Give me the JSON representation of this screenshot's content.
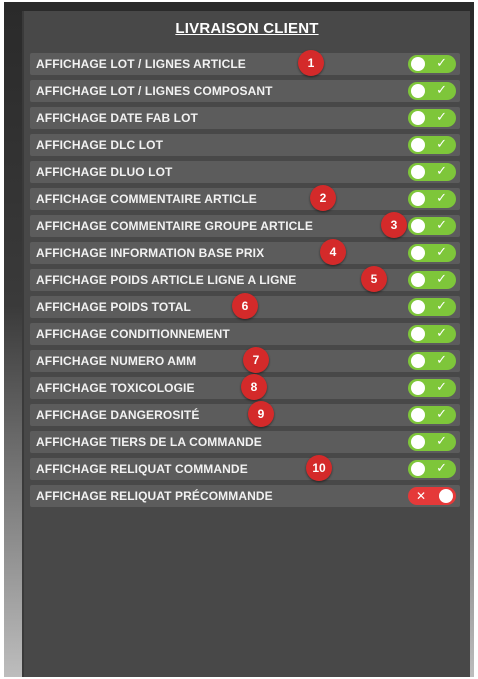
{
  "title": "LIVRAISON CLIENT",
  "colors": {
    "toggle_on": "#7ec63a",
    "toggle_off": "#e53939",
    "badge": "#d42a2a"
  },
  "rows": [
    {
      "label": "AFFICHAGE LOT / LIGNES ARTICLE",
      "enabled": true,
      "badge": "1"
    },
    {
      "label": "AFFICHAGE LOT / LIGNES COMPOSANT",
      "enabled": true,
      "badge": ""
    },
    {
      "label": "AFFICHAGE DATE FAB LOT",
      "enabled": true,
      "badge": ""
    },
    {
      "label": "AFFICHAGE DLC LOT",
      "enabled": true,
      "badge": ""
    },
    {
      "label": "AFFICHAGE DLUO LOT",
      "enabled": true,
      "badge": ""
    },
    {
      "label": "AFFICHAGE COMMENTAIRE ARTICLE",
      "enabled": true,
      "badge": "2"
    },
    {
      "label": "AFFICHAGE COMMENTAIRE GROUPE ARTICLE",
      "enabled": true,
      "badge": "3"
    },
    {
      "label": "AFFICHAGE INFORMATION BASE PRIX",
      "enabled": true,
      "badge": "4"
    },
    {
      "label": "AFFICHAGE POIDS ARTICLE LIGNE A LIGNE",
      "enabled": true,
      "badge": "5"
    },
    {
      "label": "AFFICHAGE POIDS TOTAL",
      "enabled": true,
      "badge": "6"
    },
    {
      "label": "AFFICHAGE CONDITIONNEMENT",
      "enabled": true,
      "badge": ""
    },
    {
      "label": "AFFICHAGE NUMERO AMM",
      "enabled": true,
      "badge": "7"
    },
    {
      "label": "AFFICHAGE TOXICOLOGIE",
      "enabled": true,
      "badge": "8"
    },
    {
      "label": "AFFICHAGE DANGEROSITÉ",
      "enabled": true,
      "badge": "9"
    },
    {
      "label": "AFFICHAGE TIERS DE LA COMMANDE",
      "enabled": true,
      "badge": ""
    },
    {
      "label": "AFFICHAGE RELIQUAT COMMANDE",
      "enabled": true,
      "badge": "10"
    },
    {
      "label": "AFFICHAGE RELIQUAT PRÉCOMMANDE",
      "enabled": false,
      "badge": ""
    }
  ]
}
